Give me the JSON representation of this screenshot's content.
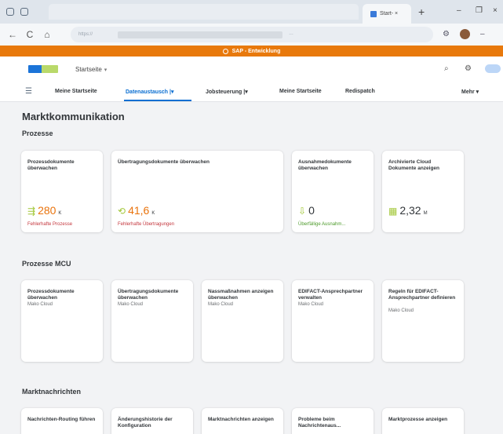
{
  "browser": {
    "active_tab_label": "Start- ×",
    "new_tab": "+",
    "nav_back": "←",
    "nav_forward": "→",
    "nav_reload": "C",
    "home": "⌂",
    "url_prefix": "https://",
    "url_tail": "…",
    "min": "–",
    "restore": "❐",
    "close": "×"
  },
  "banner": {
    "text": "SAP - Entwicklung"
  },
  "shell": {
    "title": "Startseite",
    "caret": "▾"
  },
  "nav": {
    "tabs": [
      {
        "label": "Meine Startseite"
      },
      {
        "label": "Datenaustausch",
        "caret": "|▾"
      },
      {
        "label": "Jobsteuerung",
        "caret": "|▾"
      },
      {
        "label": "Meine Startseite"
      },
      {
        "label": "Redispatch"
      }
    ],
    "more": "Mehr ▾"
  },
  "page": {
    "title": "Marktkommunikation"
  },
  "sections": {
    "prozesse": {
      "title": "Prozesse",
      "tiles": [
        {
          "title": "Prozessdokumente überwachen",
          "kpi": "280",
          "unit": "K",
          "icon": "⇶",
          "kpi_sub": "Fehlerhafte Prozesse"
        },
        {
          "title": "Übertragungsdokumente überwachen",
          "kpi": "41,6",
          "unit": "K",
          "icon": "⟲",
          "kpi_sub": "Fehlerhafte Übertragungen"
        },
        {
          "title": "Ausnahmedokumente überwachen",
          "kpi": "0",
          "unit": "",
          "icon": "⇩",
          "kpi_sub": "Überfällige Ausnahm..."
        },
        {
          "title": "Archivierte Cloud Dokumente anzeigen",
          "kpi": "2,32",
          "unit": "M",
          "icon": "▦",
          "kpi_sub": ""
        }
      ]
    },
    "prozesse_mcu": {
      "title": "Prozesse MCU",
      "tiles": [
        {
          "title": "Prozessdokumente überwachen",
          "sub": "Mako Cloud"
        },
        {
          "title": "Übertragungsdokumente überwachen",
          "sub": "Mako Cloud"
        },
        {
          "title": "Nassmaßnahmen anzeigen überwachen",
          "sub": "Mako Cloud"
        },
        {
          "title": "EDIFACT-Ansprechpartner verwalten",
          "sub": "Mako Cloud"
        },
        {
          "title": "Regeln für EDIFACT-Ansprechpartner definieren",
          "sub": "Mako Cloud"
        }
      ]
    },
    "marktnachrichten": {
      "title": "Marktnachrichten",
      "tiles": [
        {
          "title": "Nachrichten-Routing führen"
        },
        {
          "title": "Änderungshistorie der Konfiguration"
        },
        {
          "title": "Marktnachrichten anzeigen"
        },
        {
          "title": "Probleme beim Nachrichtenaus..."
        },
        {
          "title": "Marktprozesse anzeigen"
        }
      ]
    }
  },
  "colors": {
    "banner": "#e8790c",
    "accent": "#0a6ed1",
    "kpi_orange": "#e9730c",
    "error_red": "#c4363d",
    "success_green": "#4c9a2a"
  }
}
